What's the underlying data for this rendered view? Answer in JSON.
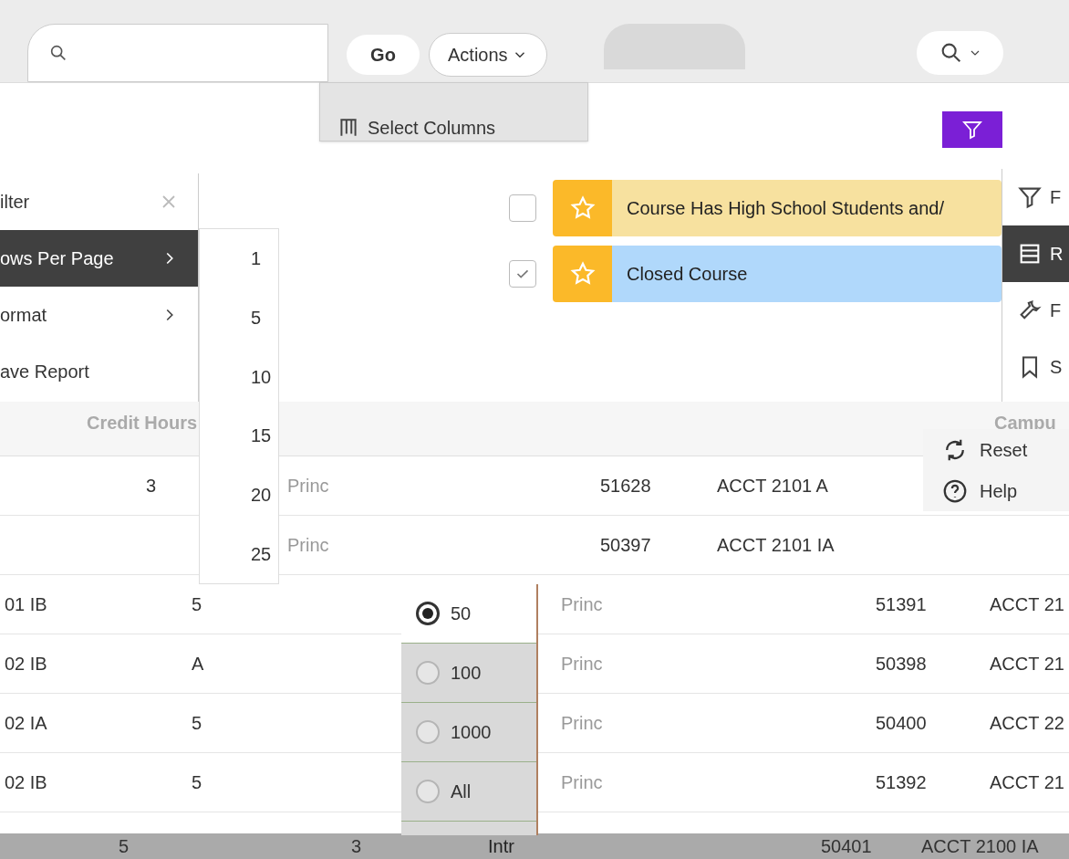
{
  "toolbar": {
    "go": "Go",
    "actions": "Actions"
  },
  "actions_menu": {
    "items": [
      {
        "label": "Select Columns"
      }
    ]
  },
  "left_menu": {
    "items": [
      {
        "label": "ilter",
        "selected": false,
        "submenu": false,
        "closable": true
      },
      {
        "label": "ows Per Page",
        "selected": true,
        "submenu": true,
        "closable": false
      },
      {
        "label": "ormat",
        "selected": false,
        "submenu": true,
        "closable": false
      },
      {
        "label": "ave Report",
        "selected": false,
        "submenu": false,
        "closable": false
      }
    ]
  },
  "rows_per_page": {
    "items": [
      {
        "kind": "plain",
        "label": "1",
        "selected": false
      },
      {
        "kind": "plain",
        "label": "5",
        "selected": false
      },
      {
        "kind": "plain",
        "label": "10",
        "selected": false
      },
      {
        "kind": "plain",
        "label": "15",
        "selected": false
      },
      {
        "kind": "plain",
        "label": "20",
        "selected": false
      },
      {
        "kind": "plain",
        "label": "25",
        "selected": false
      },
      {
        "kind": "radio",
        "label": "50",
        "selected": true
      },
      {
        "kind": "radio",
        "label": "100",
        "selected": false
      },
      {
        "kind": "radio",
        "label": "1000",
        "selected": false
      },
      {
        "kind": "radio",
        "label": "All",
        "selected": false
      }
    ]
  },
  "highlights": [
    {
      "name": "Course Has High School Students and/",
      "checked": false,
      "color": "#f7e19f"
    },
    {
      "name": "Closed Course",
      "checked": true,
      "color": "#b0d8fb"
    }
  ],
  "right_menu": {
    "items": [
      {
        "kind": "filter",
        "label": "F",
        "selected": false
      },
      {
        "kind": "rows",
        "label": "R",
        "selected": true
      },
      {
        "kind": "wrench",
        "label": "F",
        "selected": false
      },
      {
        "kind": "bookmark",
        "label": "S",
        "selected": false
      }
    ]
  },
  "extra_menu": {
    "items": [
      {
        "kind": "reset",
        "label": "Reset"
      },
      {
        "kind": "help",
        "label": "Help"
      }
    ]
  },
  "table": {
    "columns": [
      "Credit Hours",
      "",
      "",
      "",
      "Campu"
    ],
    "rows": [
      {
        "kind": "upper",
        "cells": [
          "3",
          "Princ",
          "51628",
          "ACCT 2101 A"
        ]
      },
      {
        "kind": "upper",
        "cells": [
          null,
          "Princ",
          "50397",
          "ACCT 2101 IA"
        ]
      },
      {
        "kind": "body",
        "cells": [
          "01 IB",
          "5",
          "Princ",
          "51391",
          "ACCT 21"
        ]
      },
      {
        "kind": "body",
        "cells": [
          "02 IB",
          "A",
          "Princ",
          "50398",
          "ACCT 21"
        ]
      },
      {
        "kind": "body",
        "cells": [
          "02 IA",
          "5",
          "Princ",
          "50400",
          "ACCT 22"
        ]
      },
      {
        "kind": "body",
        "cells": [
          "02 IB",
          "5",
          "Princ",
          "51392",
          "ACCT 21"
        ]
      },
      {
        "kind": "footer",
        "cells": [
          "5",
          "3",
          "Intr",
          "50401",
          "ACCT 2100 IA"
        ]
      }
    ]
  }
}
